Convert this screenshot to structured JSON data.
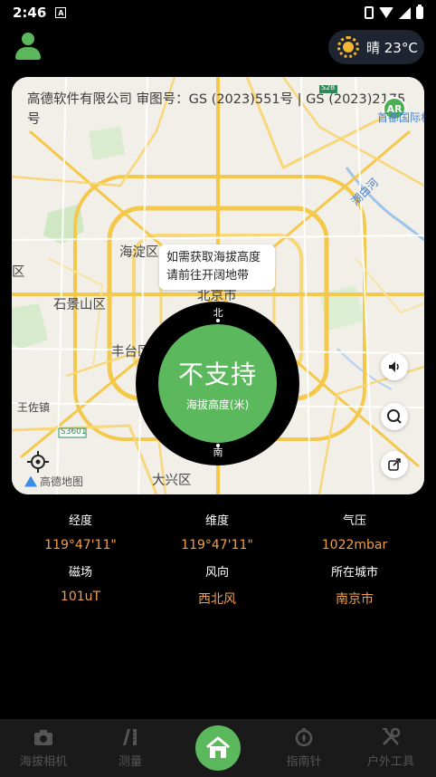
{
  "status": {
    "time": "2:46",
    "app_icon": "A"
  },
  "weather": {
    "text": "晴 23°C",
    "icon": "sun-icon"
  },
  "map": {
    "copyright": "高德软件有限公司 审图号：GS (2023)551号 | GS (2023)2175号",
    "places": {
      "haidian": "海淀区",
      "shijingshan": "石景山区",
      "fengtai": "丰台区",
      "beijing": "北京市",
      "daxing": "大兴区",
      "wangzuo": "王佐镇",
      "capital_airport": "首都国际机场",
      "chaobai": "潮白河",
      "qu": "区",
      "road_s3601": "S3601",
      "road_s28": "S28"
    },
    "ar_badge": "AR",
    "tooltip_line1": "如需获取海拔高度",
    "tooltip_line2": "请前往开阔地带",
    "logo_text": "高德地图"
  },
  "compass": {
    "value": "不支持",
    "unit": "海拔高度(米)",
    "north": "北",
    "south": "南"
  },
  "readings": [
    {
      "label": "经度",
      "value": "119°47'11\""
    },
    {
      "label": "维度",
      "value": "119°47'11\""
    },
    {
      "label": "气压",
      "value": "1022mbar"
    },
    {
      "label": "磁场",
      "value": "101uT"
    },
    {
      "label": "风向",
      "value": "西北风"
    },
    {
      "label": "所在城市",
      "value": "南京市"
    }
  ],
  "nav": [
    {
      "label": "海拔相机",
      "icon": "camera-icon"
    },
    {
      "label": "测量",
      "icon": "ruler-icon"
    },
    {
      "label": "",
      "icon": "home-icon"
    },
    {
      "label": "指南针",
      "icon": "compass-icon"
    },
    {
      "label": "户外工具",
      "icon": "tools-icon"
    }
  ],
  "colors": {
    "accent": "#5cb85c",
    "value_text": "#f0a04b",
    "background": "#000000"
  }
}
